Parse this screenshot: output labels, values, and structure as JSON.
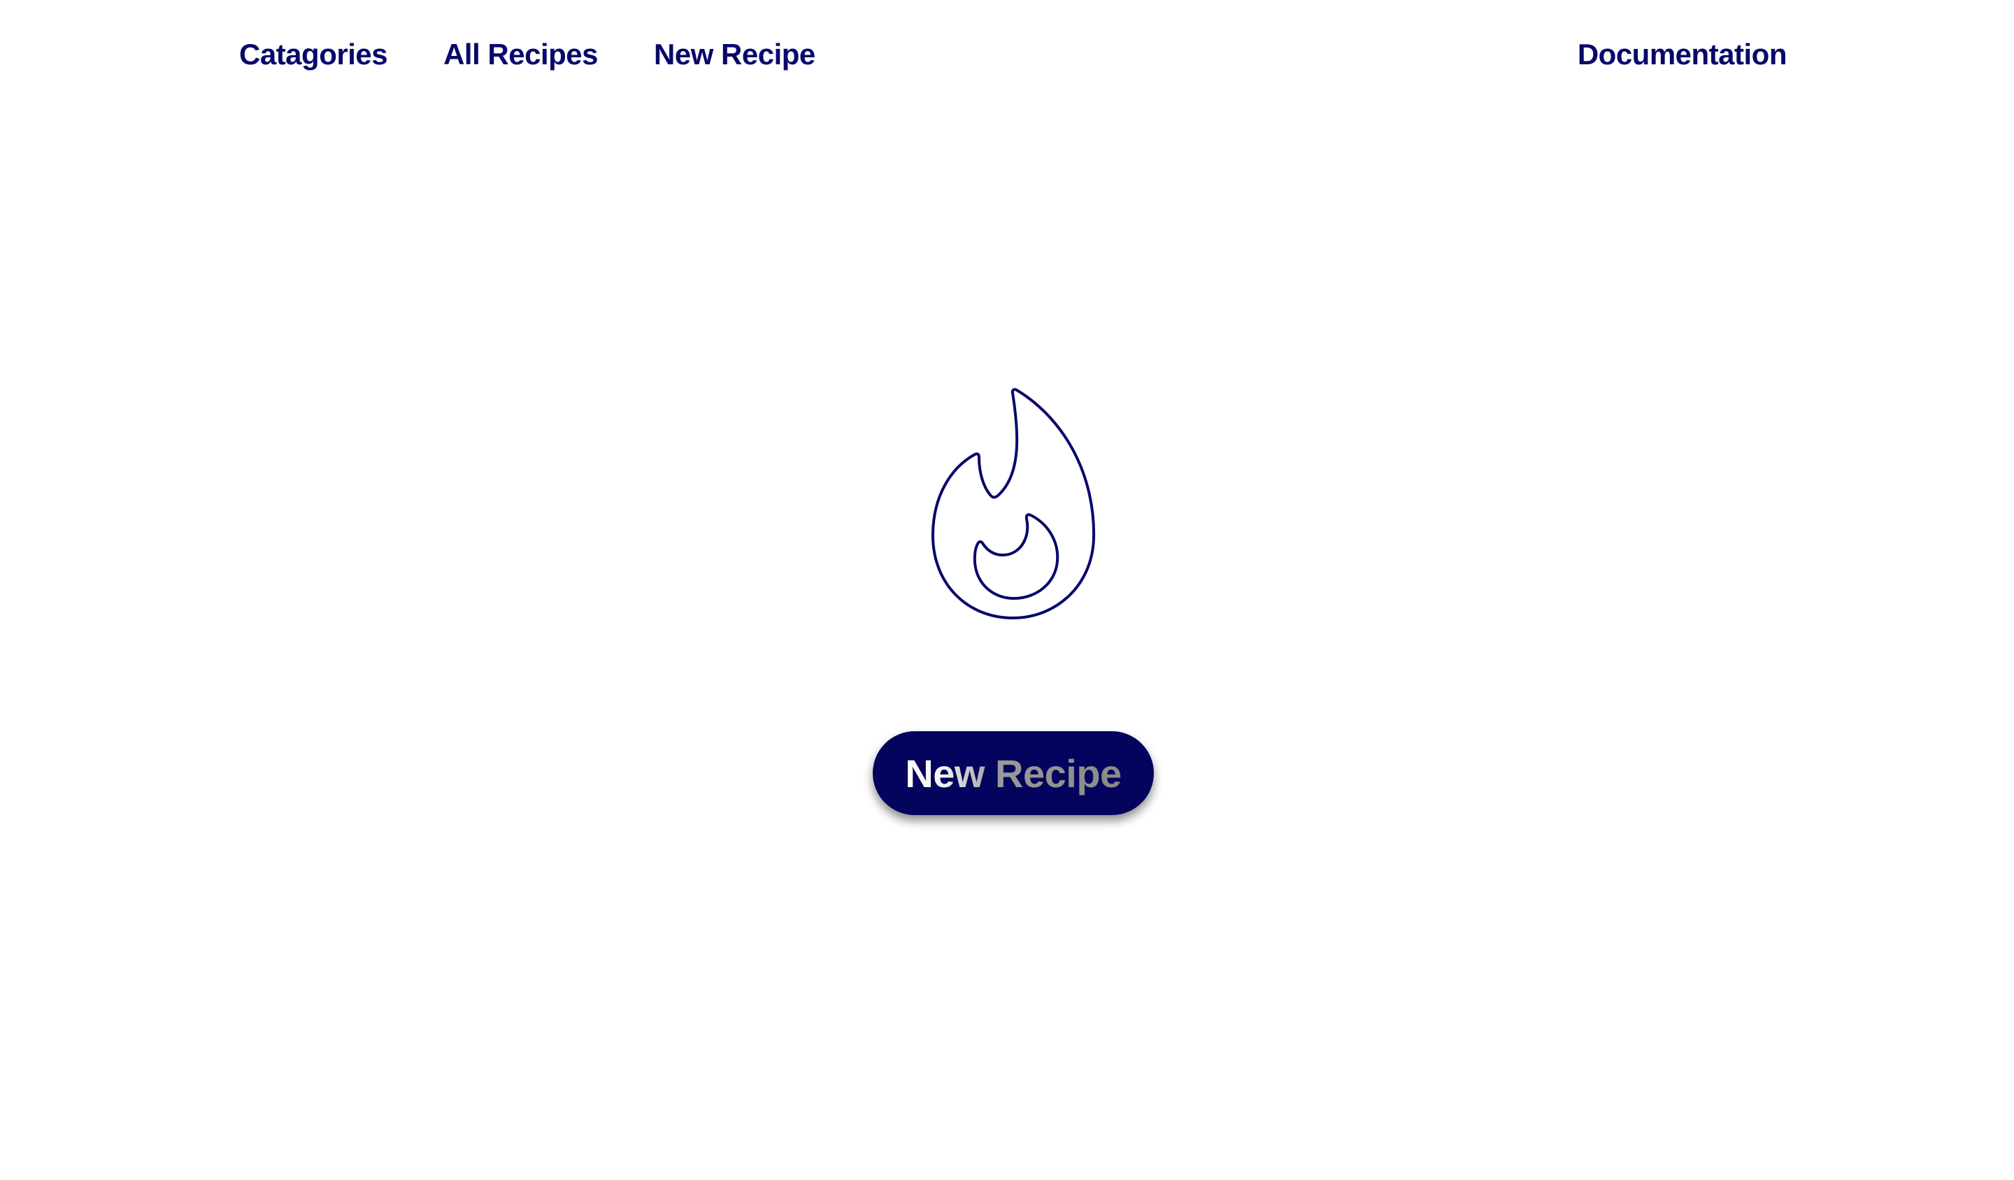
{
  "nav": {
    "categories_label": "Catagories",
    "all_recipes_label": "All Recipes",
    "new_recipe_label": "New Recipe",
    "documentation_label": "Documentation"
  },
  "hero": {
    "icon": "flame-icon",
    "cta_label": "New Recipe"
  },
  "colors": {
    "primary": "#08086b",
    "button_bg": "#04045e",
    "background": "#ffffff"
  }
}
